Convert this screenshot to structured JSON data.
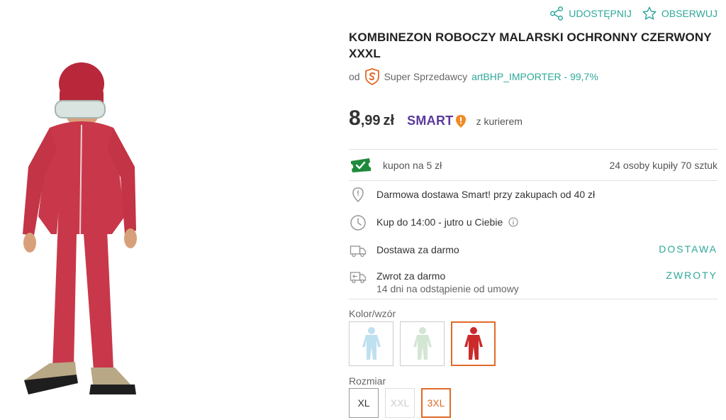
{
  "actions": {
    "share_label": "UDOSTĘPNIJ",
    "watch_label": "OBSERWUJ"
  },
  "product": {
    "title": "KOMBINEZON ROBOCZY MALARSKI OCHRONNY CZERWONY XXXL"
  },
  "seller": {
    "prefix": "od",
    "badge_label": "Super Sprzedawcy",
    "name": "artBHP_IMPORTER - 99,7%"
  },
  "price": {
    "main": "8",
    "decimal": ",99",
    "currency": "zł",
    "smart_label": "SMART",
    "courier": "z kurierem"
  },
  "coupon": {
    "label": "kupon na 5 zł",
    "bought": "24 osoby kupiły 70 sztuk"
  },
  "delivery": {
    "free_smart": "Darmowa dostawa Smart! przy zakupach od 40 zł",
    "order_by": "Kup do 14:00 - jutro u Ciebie",
    "free_shipping": "Dostawa za darmo",
    "shipping_link": "DOSTAWA",
    "return_title": "Zwrot za darmo",
    "return_sub": "14 dni na odstąpienie od umowy",
    "return_link": "ZWROTY"
  },
  "options": {
    "color_label": "Kolor/wzór",
    "size_label": "Rozmiar",
    "colors": [
      {
        "name": "light-blue",
        "hex": "#bfe0f0"
      },
      {
        "name": "light-green",
        "hex": "#d3e6d3"
      },
      {
        "name": "red",
        "hex": "#cc2a2a"
      }
    ],
    "sizes": [
      "XL",
      "XXL",
      "3XL"
    ]
  },
  "colors": {
    "accent": "#2fa89a",
    "selected": "#e06a2a",
    "smart": "#5b3a9b",
    "coupon": "#1f8a3a",
    "suit": "#c8384a"
  }
}
